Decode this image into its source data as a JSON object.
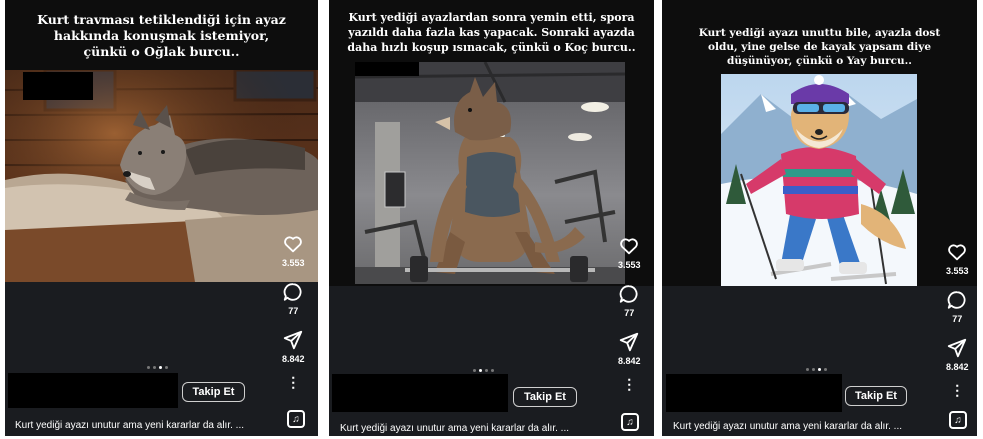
{
  "posts": [
    {
      "caption_lines": [
        "Kurt travması tetiklendiği için ayaz",
        "hakkında konuşmak istemiyor,",
        "çünkü o Oğlak burcu.."
      ],
      "likes": "3.553",
      "comments": "77",
      "shares": "8.842",
      "follow_label": "Takip Et",
      "description": "Kurt yediği ayazı unutur ama yeni kararlar da alır. ..."
    },
    {
      "caption_lines": [
        "Kurt yediği ayazlardan sonra yemin etti, spora",
        "yazıldı daha fazla kas yapacak. Sonraki ayazda",
        "daha hızlı koşup ısınacak, çünkü o Koç burcu.."
      ],
      "likes": "3.553",
      "comments": "77",
      "shares": "8.842",
      "follow_label": "Takip Et",
      "description": "Kurt yediği ayazı unutur ama yeni kararlar da alır. ..."
    },
    {
      "caption_lines": [
        "Kurt yediği ayazı unuttu bile, ayazla dost",
        "oldu, yine gelse de kayak yapsam diye",
        "düşünüyor, çünkü o Yay burcu.."
      ],
      "likes": "3.553",
      "comments": "77",
      "shares": "8.842",
      "follow_label": "Takip Et",
      "description": "Kurt yediği ayazı unutur ama yeni kararlar da alır. ..."
    }
  ],
  "icons": {
    "like": "heart-icon",
    "comment": "comment-icon",
    "share": "send-icon",
    "more": "more-vertical-icon",
    "music": "music-note-icon"
  },
  "colors": {
    "panel_bg": "#0d0d0d",
    "bottom_bar": "#1a1c20",
    "text": "#ffffff"
  }
}
